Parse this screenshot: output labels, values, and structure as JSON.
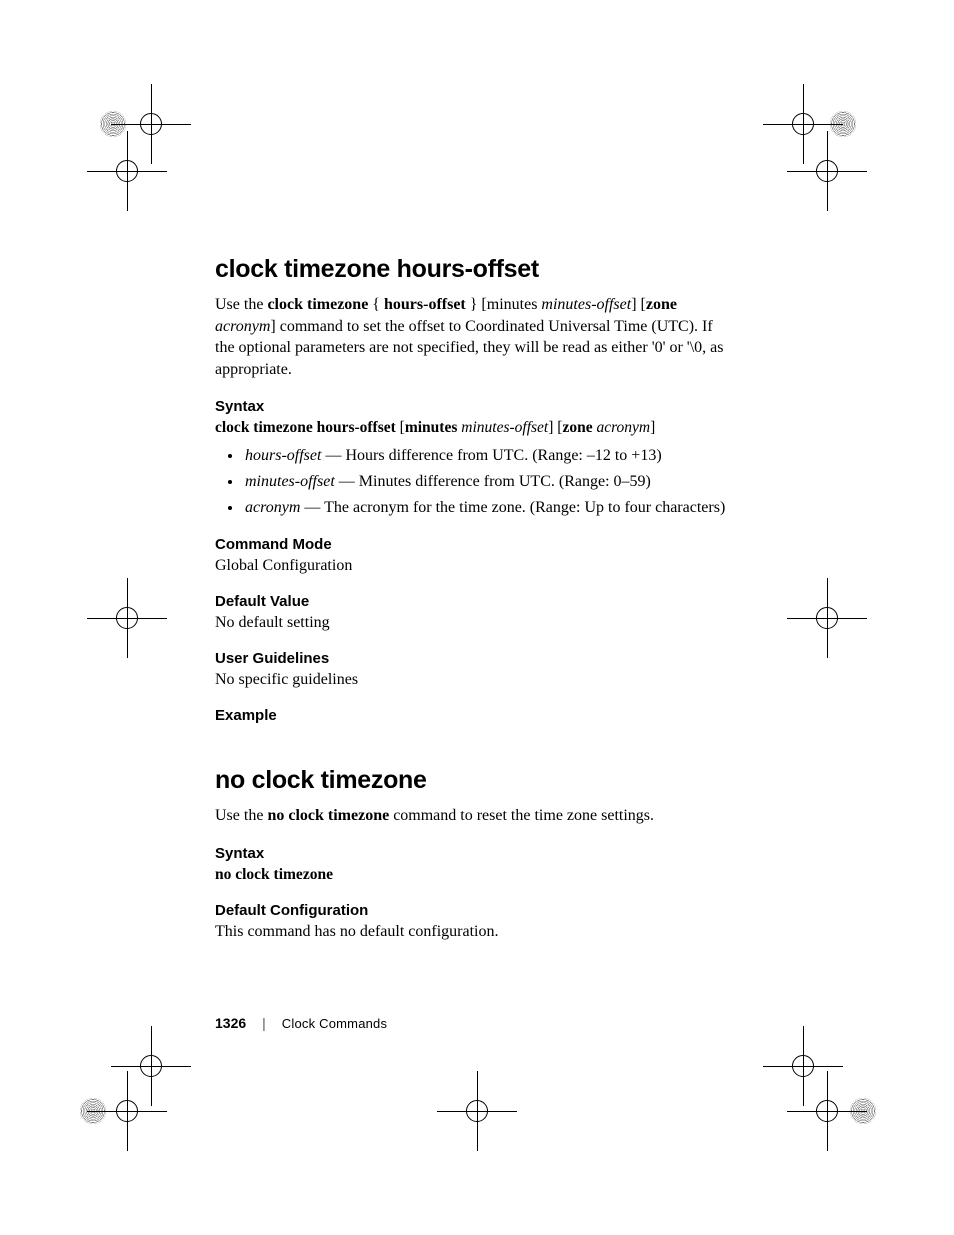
{
  "section1": {
    "title": "clock timezone hours-offset",
    "intro_html": "Use the <b>clock timezone</b> { <b>hours-offset</b> } [minutes <i>minutes-offset</i>] [<b>zone</b> <i>acronym</i>] command to set the offset to Coordinated Universal Time (UTC). If the optional parameters are not specified, they will be read as either '0' or '\\0, as appropriate.",
    "syntax_heading": "Syntax",
    "syntax_line_html": "<b>clock timezone hours-offset</b> [<b>minutes</b> <i>minutes-offset</i>] [<b>zone</b> <i>acronym</i>]",
    "params": [
      "<i>hours-offset</i> — Hours difference from UTC. (Range: –12 to +13)",
      "<i>minutes-offset</i> — Minutes difference from UTC. (Range: 0–59)",
      "<i>acronym</i> — The acronym for the time zone. (Range: Up to four characters)"
    ],
    "command_mode_heading": "Command Mode",
    "command_mode_body": "Global Configuration",
    "default_value_heading": "Default Value",
    "default_value_body": "No default setting",
    "user_guidelines_heading": "User Guidelines",
    "user_guidelines_body": "No specific guidelines",
    "example_heading": "Example"
  },
  "section2": {
    "title": "no clock timezone",
    "intro_html": "Use the <b>no clock timezone</b> command to reset the time zone settings.",
    "syntax_heading": "Syntax",
    "syntax_line_html": "<b>no clock timezone</b>",
    "default_config_heading": "Default Configuration",
    "default_config_body": "This command has no default configuration."
  },
  "footer": {
    "page_number": "1326",
    "separator": "|",
    "chapter": "Clock Commands"
  }
}
